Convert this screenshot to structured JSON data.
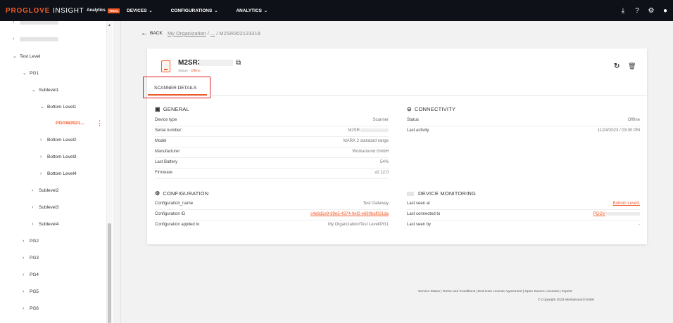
{
  "header": {
    "brand_main": "PROGLOVE",
    "brand_product": "INSIGHT",
    "brand_analytics": "Analytics",
    "brand_trial": "TRIAL",
    "nav": [
      {
        "label": "DEVICES"
      },
      {
        "label": "CONFIGURATIONS"
      },
      {
        "label": "ANALYTICS"
      }
    ],
    "icons": [
      "download-icon",
      "help-icon",
      "settings-icon",
      "account-icon"
    ]
  },
  "sidebar": {
    "items": [
      {
        "label": "Test Level"
      },
      {
        "label": "PG1"
      },
      {
        "label": "Sublevel1"
      },
      {
        "label": "Bottom Level1"
      },
      {
        "label": "PGGW2021..."
      },
      {
        "label": "Bottom Level2"
      },
      {
        "label": "Bottom Level3"
      },
      {
        "label": "Bottom Level4"
      },
      {
        "label": "Sublevel2"
      },
      {
        "label": "Sublevel3"
      },
      {
        "label": "Sublevel4"
      },
      {
        "label": "PG2"
      },
      {
        "label": "PG3"
      },
      {
        "label": "PG4"
      },
      {
        "label": "PG5"
      },
      {
        "label": "PG6"
      }
    ]
  },
  "breadcrumb": {
    "back": "BACK",
    "org": "My Organization",
    "sep1": " / ",
    "middle": "...",
    "sep2": " / ",
    "current": "M2SR302123318"
  },
  "device": {
    "title": "M2SR3",
    "status_label": "Status - ",
    "status_value": "Offline"
  },
  "tabs": {
    "scanner_details": "SCANNER DETAILS"
  },
  "general": {
    "title": "GENERAL",
    "rows": [
      {
        "key": "Device type",
        "value": "Scanner"
      },
      {
        "key": "Serial number",
        "value": "M2SR"
      },
      {
        "key": "Model",
        "value": "MARK 2 standard range"
      },
      {
        "key": "Manufacturer",
        "value": "Workaround GmbH"
      },
      {
        "key": "Last Battery",
        "value": "54%"
      },
      {
        "key": "Firmware",
        "value": "v2.12.0"
      }
    ]
  },
  "connectivity": {
    "title": "CONNECTIVITY",
    "rows": [
      {
        "key": "Status",
        "value": "Offline"
      },
      {
        "key": "Last activity",
        "value": "11/24/2023 / 03:00 PM"
      }
    ]
  },
  "configuration": {
    "title": "CONFIGURATION",
    "rows": [
      {
        "key": "Configuration_name",
        "value": "Test Gateway"
      },
      {
        "key": "Configuration ID",
        "value": "c4e8d1e9-89e5-4374-9ef2-e690baf021da"
      },
      {
        "key": "Configuration applied to",
        "value": "My Organization/Test Level/PG1"
      }
    ]
  },
  "monitoring": {
    "title": "DEVICE MONITORING",
    "rows": [
      {
        "key": "Last seen at",
        "value": "Bottom Level1"
      },
      {
        "key": "Last connected to",
        "value": "PGGV"
      },
      {
        "key": "Last seen by",
        "value": "-"
      }
    ]
  },
  "footer": {
    "links": "Service Status | Terms and Conditions | End User License Agreement | Open Source Licenses | Imprint",
    "copyright": "© Copyright 2023 Workaround GmbH"
  },
  "colors": {
    "accent": "#f05a28",
    "topbar": "#0e1117",
    "highlight_box": "#e02020"
  }
}
